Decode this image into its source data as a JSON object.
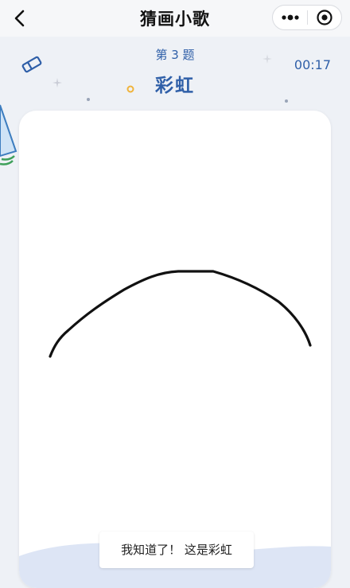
{
  "navbar": {
    "title": "猜画小歌",
    "back_icon": "chevron-left-icon",
    "more_icon": "more-dots-icon",
    "close_icon": "target-close-icon"
  },
  "game": {
    "question_label": "第 3 题",
    "answer_word": "彩虹",
    "timer": "00:17",
    "eraser_icon": "eraser-icon"
  },
  "canvas": {
    "toast_text": "我知道了！ 这是彩虹"
  },
  "colors": {
    "accent": "#2f5fa8",
    "background": "#eef1f6",
    "stroke": "#111111"
  }
}
